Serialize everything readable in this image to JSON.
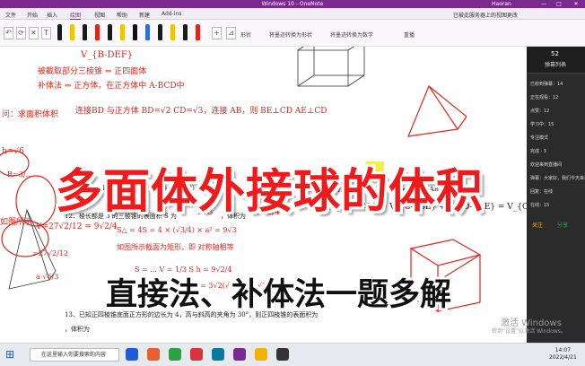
{
  "window": {
    "title": "Windows 10 - OneNote",
    "user": "Haoran",
    "minimize": "—",
    "maximize": "□",
    "close": "✕"
  },
  "tabs": [
    "文件",
    "开始",
    "插入",
    "绘图",
    "视图",
    "帮助",
    "新建",
    "Add-ins"
  ],
  "tabs_right": "已被此服务器上的视图更改",
  "ribbon": {
    "pens": [
      "#1a1a1a",
      "#f2c500",
      "#1a1a1a",
      "#e0261c",
      "#1a1a1a",
      "#f2c500",
      "#111111",
      "#2d6fd6",
      "#1a1a1a",
      "#f2c500",
      "#1a1a1a",
      "#e0261c"
    ],
    "label_shape": "形状",
    "label_ink_shape": "将墨迹转换为形状",
    "label_ink_math": "将墨迹转换为数学",
    "label_replay": "重播"
  },
  "content": {
    "banner_title": "多面体外接球的体积",
    "banner_subtitle": "直接法、补体法一题多解",
    "problem_12": "12．棱长都是 3 的三棱锥的表面积 S 为",
    "problem_12_mid": "，体积为",
    "problem_13": "13．已知正四棱锥底面正方形的边长为 4，高与斜高的夹角为 30°，则正四棱锥的表面积为",
    "problem_13_end": "，体积为",
    "ans_s": "9√3",
    "ans_v": "9√2/4",
    "note_1": "被截取部分三棱锥 ⇒ 正四面体",
    "note_2": "补体法 ⇒ 正方体，在正方体中 A-BCD中",
    "note_3": "连接BD 与正方体 BD=√2 CD=√3，连接 AB，则 BE⊥CD AE⊥CD",
    "note_4": "问：CD⊥AB CD⊥BE ⇒ CD⊥面ABE",
    "note_5": "V_{A-BCD} = V_{C-ABE} + V_{D-ABE} = V_{C-ABE}",
    "note_6": "如图所示截面为矩形，即 对称轴相等",
    "note_7": "BO = √2/2 BE = √3   AS = a   AO = √(a² - 3) = √6",
    "note_8": "S△ = 4S = 4 × (√3/4) × a² = 9√3",
    "note_9": "S = ... V = 1/3 S h = 9√2/4",
    "note_10": "V = 1/3 ... = 3√2(√2/2)² = √2/4",
    "left_1": "问：求面积体积",
    "left_2": "如图所示",
    "left_3": "V=27√2/12 = 9√2/4",
    "left_4": "=27√2/12",
    "left_5": "h=√6",
    "left_6": "R=3/...",
    "left_7": "a·√6/3",
    "vtop": "V_{B-DEF}"
  },
  "sidebar": {
    "header_num": "52",
    "header_label": "弹幕列表",
    "rows": [
      "已收到弹幕：14",
      "正在观看：12",
      "点赞：12",
      "学习中：15",
      "专注模式",
      "完成 · 3",
      "欢迎来到直播间",
      "弹幕：大家好，我们今天来讲",
      "回复：在线",
      "在线：15"
    ],
    "btn_1": "关注",
    "btn_2": "分享"
  },
  "watermark": {
    "line1": "激活 Windows",
    "line2": "转到“设置”以激活 Windows。"
  },
  "taskbar": {
    "search_placeholder": "在这里输入你要搜索的内容",
    "time": "14:07",
    "date": "2022/4/21",
    "icon_colors": [
      "#1f5bd6",
      "#e95f2d",
      "#2ea043",
      "#d9333f",
      "#0a7a9e",
      "#7a2a8e",
      "#f2b400",
      "#333333"
    ]
  }
}
